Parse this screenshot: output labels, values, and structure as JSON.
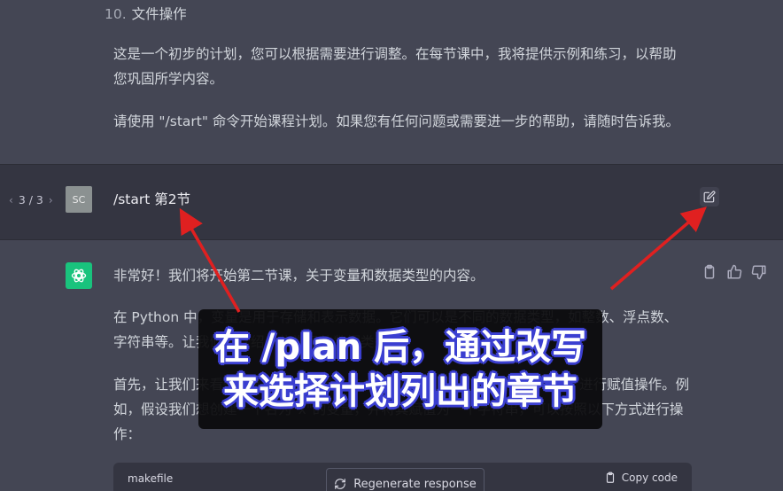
{
  "previous_response": {
    "list_item_number": "10.",
    "list_item_text": "文件操作",
    "paragraph_1": "这是一个初步的计划，您可以根据需要进行调整。在每节课中，我将提供示例和练习，以帮助您巩固所学内容。",
    "paragraph_2": "请使用 \"/start\" 命令开始课程计划。如果您有任何问题或需要进一步的帮助，请随时告诉我。"
  },
  "user_message": {
    "pager": "3 / 3",
    "avatar_initials": "SC",
    "text": "/start 第2节",
    "edit_icon": "edit-icon"
  },
  "assistant_message": {
    "paragraph_1": "非常好！我们将开始第二节课，关于变量和数据类型的内容。",
    "paragraph_2": "在 Python 中，变量是用于存储和表示数据。它们可以是不同的数据类型，如整数、浮点数、字符串等。让我们来介绍一些常见的数据类型。",
    "paragraph_3": "首先，让我们来看一下如何创建变量。在 Python 中，您可以使用等号（=）进行赋值操作。例如，假设我们想创建一个名为\"x\"的变量，并将其赋值为一个字符串，可以按照以下方式进行操作：",
    "icons": [
      "clipboard-icon",
      "thumbs-up-icon",
      "thumbs-down-icon"
    ]
  },
  "code_block": {
    "language": "makefile",
    "copy_label": "Copy code"
  },
  "regenerate_label": "Regenerate response",
  "overlay_caption": {
    "line_1": "在 /plan 后，通过改写",
    "line_2": "来选择计划列出的章节"
  },
  "colors": {
    "assistant_bg": "#444654",
    "user_bg": "#343541",
    "gpt_avatar": "#19c37d",
    "arrow_red": "#e02020",
    "caption_outline": "#3b3fd1"
  }
}
